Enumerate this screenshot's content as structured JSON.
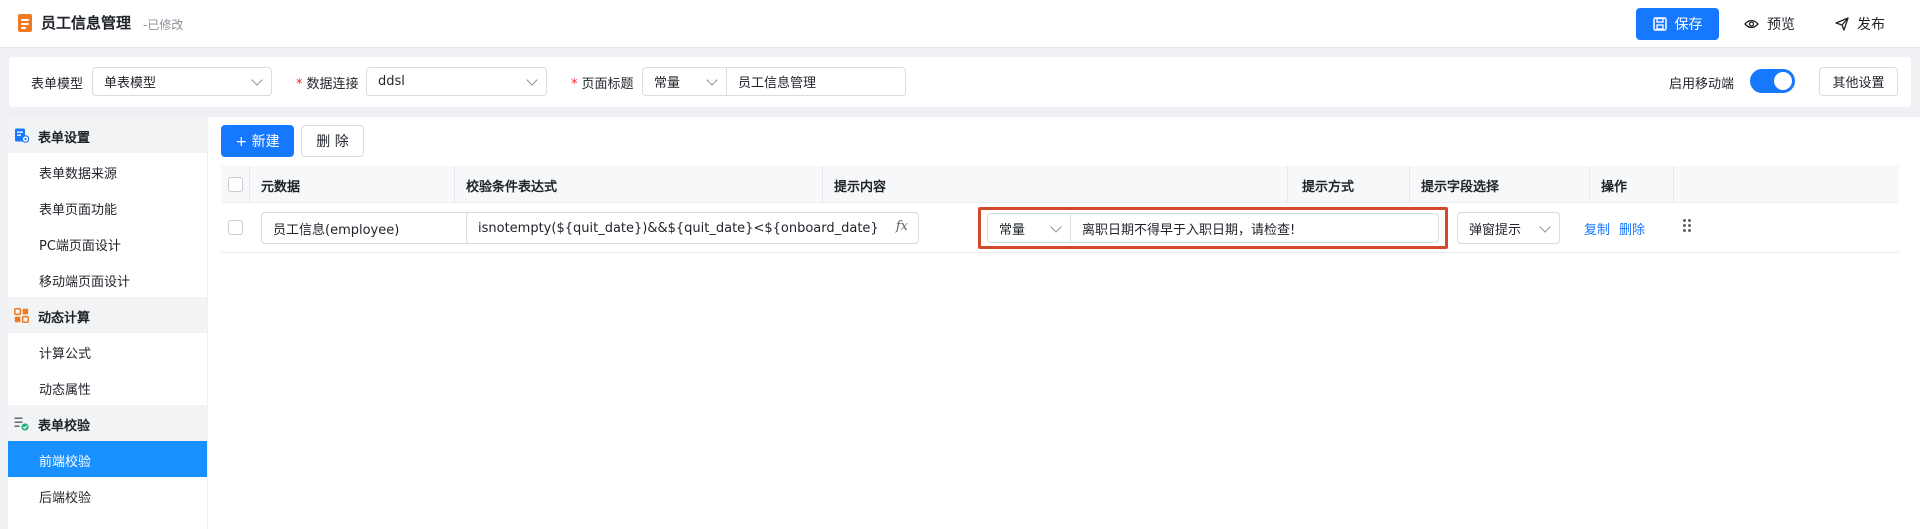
{
  "header": {
    "title": "员工信息管理",
    "status": "-已修改",
    "save_label": "保存",
    "preview_label": "预览",
    "publish_label": "发布"
  },
  "config": {
    "form_model_label": "表单模型",
    "form_model_value": "单表模型",
    "data_connection_label": "数据连接",
    "data_connection_value": "ddsl",
    "page_title_label": "页面标题",
    "page_title_type": "常量",
    "page_title_value": "员工信息管理",
    "mobile_label": "启用移动端",
    "mobile_enabled": true,
    "other_settings_label": "其他设置"
  },
  "sidebar": {
    "groups": [
      {
        "label": "表单设置",
        "icon": "form-settings-icon",
        "items": [
          "表单数据来源",
          "表单页面功能",
          "PC端页面设计",
          "移动端页面设计"
        ]
      },
      {
        "label": "动态计算",
        "icon": "grid-calc-icon",
        "items": [
          "计算公式",
          "动态属性"
        ]
      },
      {
        "label": "表单校验",
        "icon": "form-check-icon",
        "items": [
          "前端校验",
          "后端校验"
        ]
      }
    ],
    "active_item": "前端校验"
  },
  "toolbar": {
    "new_label": "+ 新建",
    "delete_label": "删 除"
  },
  "table": {
    "columns": [
      "元数据",
      "校验条件表达式",
      "提示内容",
      "提示方式",
      "提示字段选择",
      "操作"
    ],
    "rows": [
      {
        "metadata": "员工信息(employee)",
        "expression": "isnotempty(${quit_date})&&${quit_date}<${onboard_date}",
        "hint_type": "常量",
        "hint_content": "离职日期不得早于入职日期，请检查!",
        "hint_mode": "弹窗提示",
        "hint_field": "",
        "actions": [
          "复制",
          "删除"
        ]
      }
    ]
  },
  "colors": {
    "primary": "#1677ff",
    "highlight_border": "#d14a2c",
    "app_icon": "#f07a22"
  }
}
